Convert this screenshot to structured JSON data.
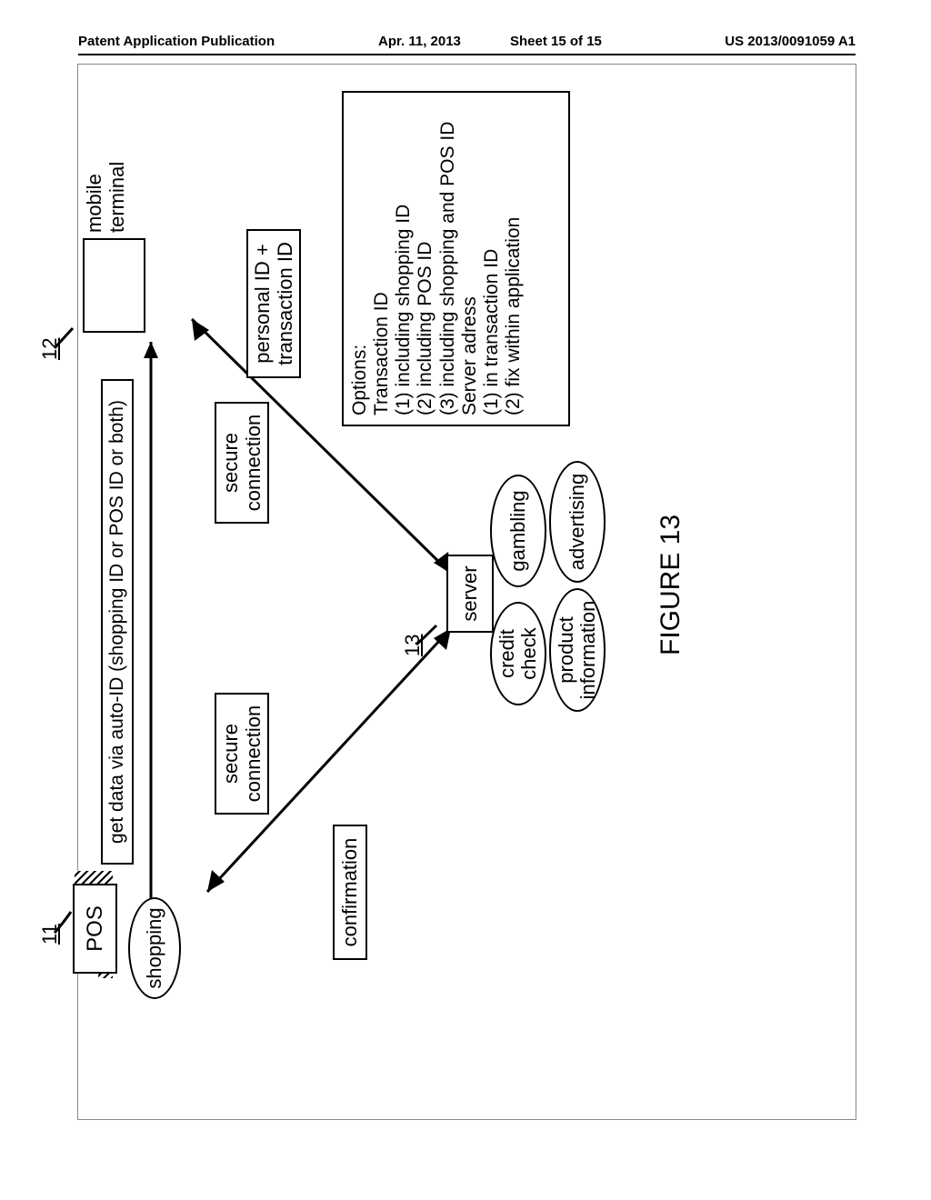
{
  "header": {
    "publication": "Patent Application Publication",
    "date": "Apr. 11, 2013",
    "sheet": "Sheet 15 of 15",
    "number": "US 2013/0091059 A1"
  },
  "refs": {
    "pos": "11",
    "mobile": "12",
    "server": "13"
  },
  "nodes": {
    "pos": "POS",
    "mobile": "mobile\nterminal",
    "server": "server",
    "shopping": "shopping",
    "credit": "credit\ncheck",
    "gambling": "gambling",
    "product": "product\ninformation",
    "advertising": "advertising"
  },
  "edges": {
    "autoid": "get data via auto-ID (shopping ID or POS ID or both)",
    "secure1": "secure\nconnection",
    "secure2": "secure\nconnection",
    "confirmation": "confirmation",
    "personal": "personal ID +\ntransaction ID"
  },
  "options_box": "Options:\nTransaction ID\n(1) including shopping ID\n(2) including POS ID\n(3) including shopping and POS ID\nServer adress\n(1) in transaction ID\n(2) fix within application",
  "figure_caption": "FIGURE 13"
}
